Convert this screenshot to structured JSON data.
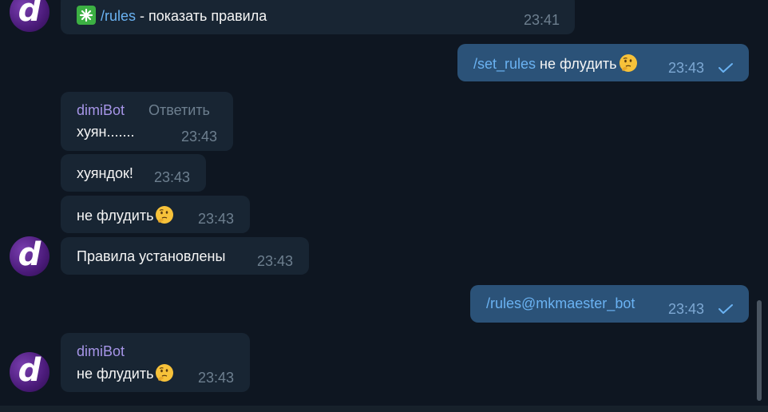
{
  "messages": {
    "m1": {
      "cmd": "/rules",
      "text": " - показать правила",
      "time": "23:41",
      "sparkle_icon": "eight-spoked-asterisk-emoji"
    },
    "m2": {
      "cmd": "/set_rules",
      "text": " не флудить",
      "time": "23:43",
      "emoji": "thinking-face-emoji"
    },
    "m3": {
      "author": "dimiBot",
      "reply_label": "Ответить",
      "text": "хуян.......",
      "time": "23:43"
    },
    "m4": {
      "text": "хуяндок!",
      "time": "23:43"
    },
    "m5": {
      "text": "не флудить",
      "time": "23:43",
      "emoji": "thinking-face-emoji"
    },
    "m6": {
      "text": "Правила установлены",
      "time": "23:43"
    },
    "m7": {
      "cmd": "/rules@mkmaester_bot",
      "time": "23:43"
    },
    "m8": {
      "author": "dimiBot",
      "text": "не флудить",
      "time": "23:43",
      "emoji": "thinking-face-emoji"
    }
  },
  "avatar": {
    "letter": "d"
  },
  "colors": {
    "background": "#0e1621",
    "incoming_bubble": "#182533",
    "outgoing_bubble": "#2b5278",
    "author": "#a695e7",
    "command_link": "#6ab2f2"
  }
}
